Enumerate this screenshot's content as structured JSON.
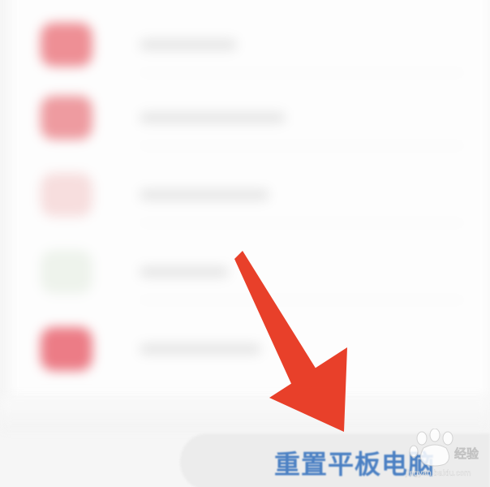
{
  "settings_list": {
    "rows": [
      {
        "icon_color": "#ee8f95"
      },
      {
        "icon_color": "#ee9ba0"
      },
      {
        "icon_color": "#f7dede"
      },
      {
        "icon_color": "#eef3ec"
      },
      {
        "icon_color": "#ec7c86"
      }
    ]
  },
  "reset_button": {
    "label": "重置平板电脑"
  },
  "annotation": {
    "arrow_color": "#e8402a"
  },
  "watermark": {
    "text": "Baidu 经验",
    "url": "jingyan.baidu.com"
  }
}
